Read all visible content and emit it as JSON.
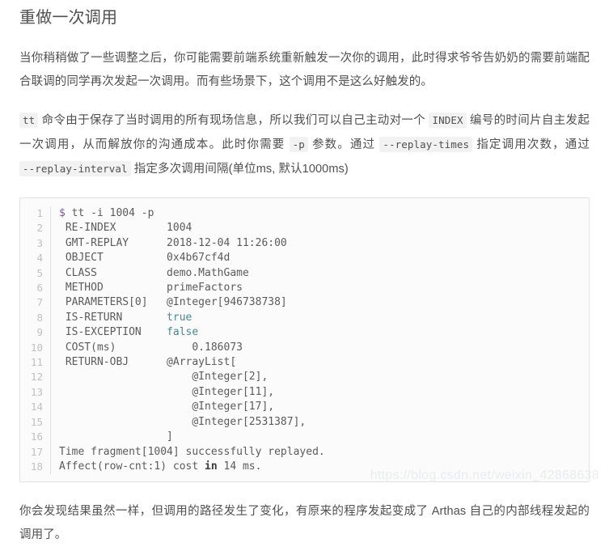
{
  "article": {
    "heading": "重做一次调用",
    "paragraphs": {
      "intro": "当你稍稍做了一些调整之后，你可能需要前端系统重新触发一次你的调用，此时得求爷爷告奶奶的需要前端配合联调的同学再次发起一次调用。而有些场景下，这个调用不是这么好触发的。",
      "detail": {
        "code_tt": "tt",
        "seg1": " 命令由于保存了当时调用的所有现场信息，所以我们可以自己主动对一个 ",
        "code_index": "INDEX",
        "seg2": " 编号的时间片自主发起一次调用，从而解放你的沟通成本。此时你需要 ",
        "code_p": "-p",
        "seg3": " 参数。通过 ",
        "code_replay_times": "--replay-times",
        "seg4": " 指定调用次数，通过 ",
        "code_replay_interval": "--replay-interval",
        "seg5": " 指定多次调用间隔(单位ms, 默认1000ms)"
      },
      "outro": "你会发现结果虽然一样，但调用的路径发生了变化，有原来的程序发起变成了 Arthas 自己的内部线程发起的调用了。"
    }
  },
  "code_block": {
    "language": "shell",
    "line_count": 18,
    "lines": [
      {
        "no": "1",
        "text": "$ tt -i 1004 -p",
        "prompt": "$",
        "rest": " tt -i 1004 -p"
      },
      {
        "no": "2",
        "text": " RE-INDEX        1004"
      },
      {
        "no": "3",
        "text": " GMT-REPLAY      2018-12-04 11:26:00"
      },
      {
        "no": "4",
        "text": " OBJECT          0x4b67cf4d"
      },
      {
        "no": "5",
        "text": " CLASS           demo.MathGame"
      },
      {
        "no": "6",
        "text": " METHOD          primeFactors"
      },
      {
        "no": "7",
        "text": " PARAMETERS[0]   @Integer[946738738]"
      },
      {
        "no": "8",
        "pre": " IS-RETURN       ",
        "bool": "true",
        "post": ""
      },
      {
        "no": "9",
        "pre": " IS-EXCEPTION    ",
        "bool": "false",
        "post": ""
      },
      {
        "no": "10",
        "text": " COST(ms)            0.186073"
      },
      {
        "no": "11",
        "text": " RETURN-OBJ      @ArrayList["
      },
      {
        "no": "12",
        "text": "                     @Integer[2],"
      },
      {
        "no": "13",
        "text": "                     @Integer[11],"
      },
      {
        "no": "14",
        "text": "                     @Integer[17],"
      },
      {
        "no": "15",
        "text": "                     @Integer[2531387],"
      },
      {
        "no": "16",
        "text": "                 ]"
      },
      {
        "no": "17",
        "text": "Time fragment[1004] successfully replayed."
      },
      {
        "no": "18",
        "pre": "Affect(row-cnt:1) cost ",
        "kw": "in",
        "post": " 14 ms."
      }
    ]
  },
  "watermark": {
    "text": "https://blog.csdn.net/weixin_42868638"
  },
  "colors": {
    "text": "#4f4f4f",
    "code_bg": "#fbfbfb",
    "code_border": "#e3e3e3",
    "inline_code_bg": "#f2f2f2",
    "line_number": "#c0c0c0",
    "boolean_token": "#3f8a96",
    "prompt_token": "#7a56a6",
    "watermark": "#eaeced"
  }
}
